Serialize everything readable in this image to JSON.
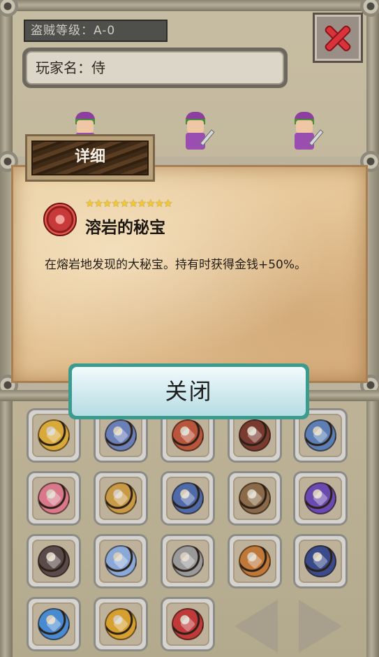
{
  "header": {
    "rank_label": "盗贼等级：A-0",
    "player_name": "玩家名：侍"
  },
  "detail": {
    "tab_label": "详细",
    "stars": "★★★★★★★★★★",
    "star_count": 10,
    "item_name": "溶岩的秘宝",
    "item_description": "在熔岩地发现的大秘宝。持有时获得金钱+50%。",
    "icon": "lava-treasure-medal-icon"
  },
  "close_button_label": "关闭",
  "grid": {
    "slots": [
      {
        "icon": "golden-star-medal-icon",
        "color": "#d9a93a"
      },
      {
        "icon": "blue-dragon-eye-icon",
        "color": "#6a7fb8"
      },
      {
        "icon": "crossed-swords-shield-icon",
        "color": "#b9553a"
      },
      {
        "icon": "dark-spider-emblem-icon",
        "color": "#7a3a30"
      },
      {
        "icon": "blue-house-badge-icon",
        "color": "#5b7fb4"
      },
      {
        "icon": "pink-spellbook-icon",
        "color": "#d8788a"
      },
      {
        "icon": "golden-lion-head-icon",
        "color": "#c99a45"
      },
      {
        "icon": "blue-tome-scroll-icon",
        "color": "#4f6aa8"
      },
      {
        "icon": "skull-candle-icon",
        "color": "#8a6a48"
      },
      {
        "icon": "purple-slime-crown-icon",
        "color": "#6a4ab0"
      },
      {
        "icon": "dark-wolf-emblem-icon",
        "color": "#5a4a4a"
      },
      {
        "icon": "ice-crystal-shield-icon",
        "color": "#8aa8d8"
      },
      {
        "icon": "silver-ore-octagon-icon",
        "color": "#9a9a9a"
      },
      {
        "icon": "log-pile-badge-icon",
        "color": "#c07838"
      },
      {
        "icon": "dark-ore-blue-ring-icon",
        "color": "#3a4a8a"
      },
      {
        "icon": "crossed-blue-swords-icon",
        "color": "#4a8ad0"
      },
      {
        "icon": "golden-mask-badge-icon",
        "color": "#d6a030"
      },
      {
        "icon": "red-lava-medal-icon",
        "color": "#c03a3a"
      }
    ]
  },
  "nav": {
    "prev_icon": "prev-triangle-icon",
    "next_icon": "next-triangle-icon"
  }
}
